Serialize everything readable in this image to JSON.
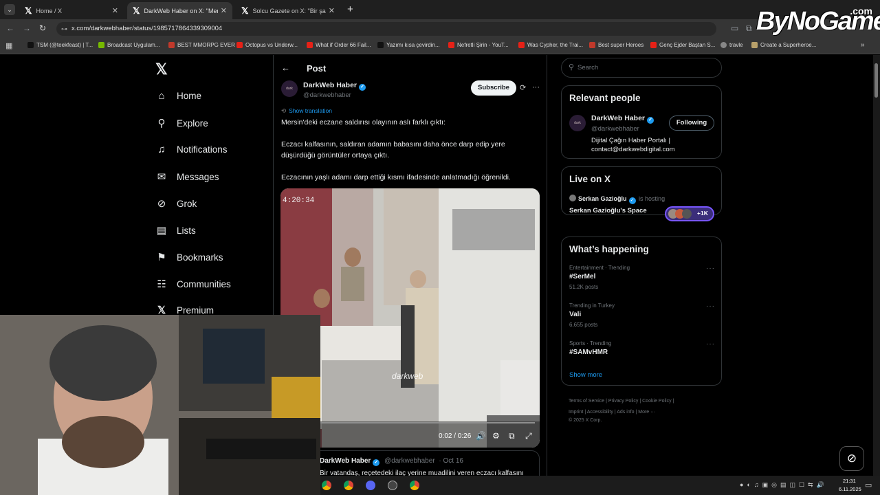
{
  "browser": {
    "tabs": [
      {
        "label": "Home / X"
      },
      {
        "label": "DarkWeb Haber on X: \"Mersin'd"
      },
      {
        "label": "Solcu Gazete on X: \"Bir şahıs, Ya"
      }
    ],
    "url": "x.com/darkwebhaber/status/1985717864339309004",
    "bookmarks": [
      "TSM (@teekfeast) | T...",
      "Broadcast Uygulam...",
      "BEST MMORPG EVER",
      "Octopus vs Underw...",
      "What if Order 66 Fail...",
      "Yazımı kısa çevirdin...",
      "Nefretli Şirin - YouT...",
      "Was Cypher, the Trai...",
      "Best super Heroes",
      "Genç Ejder Baştan S...",
      "travle",
      "Create a Superheroe..."
    ]
  },
  "watermark": {
    "text": "ByNoGame",
    "suffix": ".com"
  },
  "nav": {
    "items": [
      {
        "label": "Home"
      },
      {
        "label": "Explore"
      },
      {
        "label": "Notifications"
      },
      {
        "label": "Messages"
      },
      {
        "label": "Grok"
      },
      {
        "label": "Lists"
      },
      {
        "label": "Bookmarks"
      },
      {
        "label": "Communities"
      },
      {
        "label": "Premium"
      }
    ]
  },
  "post": {
    "header_title": "Post",
    "author_name": "DarkWeb Haber",
    "author_handle": "@darkwebhaber",
    "subscribe_label": "Subscribe",
    "show_translation": "Show translation",
    "text_1": "Mersin'deki eczane saldırısı olayının aslı farklı çıktı:",
    "text_2": "Eczacı kalfasının, saldıran adamın babasını daha önce darp edip yere düşürdüğü görüntüler ortaya çıktı.",
    "text_3": "Eczacının yaşlı adamı darp ettiği kısmı ifadesinde anlatmadığı öğrenildi.",
    "video": {
      "timestamp": "4:20:34",
      "watermark": "darkweb",
      "time": "0:02 / 0:26",
      "progress": 0.077
    }
  },
  "quoted": {
    "author_name": "DarkWeb Haber",
    "author_handle": "@darkwebhaber",
    "date": "· Oct 16",
    "text": "Bir vatandaş, reçetedeki ilaç yerine muadilini veren eczacı kalfasını"
  },
  "sidebar": {
    "search_placeholder": "Search",
    "relevant_title": "Relevant people",
    "person_name": "DarkWeb Haber",
    "person_handle": "@darkwebhaber",
    "follow_label": "Following",
    "person_bio": "Dijital Çağın Haber Portalı | contact@darkwebdigital.com",
    "live_title": "Live on X",
    "live_host": "Serkan Gazioğlu",
    "live_hosting": "is hosting",
    "live_space": "Serkan Gazioğlu's Space",
    "live_count": "+1K",
    "happening_title": "What’s happening",
    "trends": [
      {
        "context": "Entertainment · Trending",
        "name": "#SerMel",
        "posts": "51.2K posts"
      },
      {
        "context": "Trending in Turkey",
        "name": "Vali",
        "posts": "6,655 posts"
      },
      {
        "context": "Sports · Trending",
        "name": "#SAMvHMR",
        "posts": ""
      }
    ],
    "show_more": "Show more",
    "footer": [
      "Terms of Service",
      "Privacy Policy",
      "Cookie Policy",
      "Imprint",
      "Accessibility",
      "Ads info",
      "More ···",
      "© 2025 X Corp."
    ]
  },
  "taskbar": {
    "time": "21:31",
    "date": "6.11.2025"
  }
}
